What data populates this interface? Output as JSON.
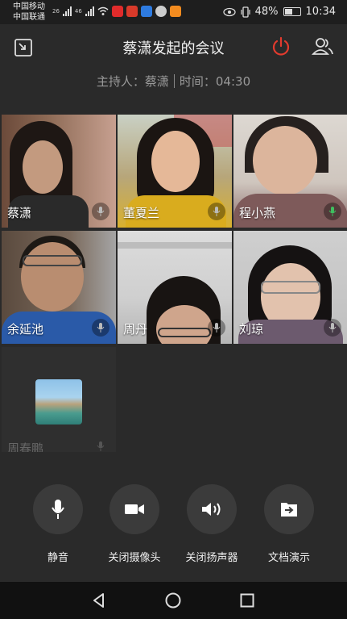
{
  "status_bar": {
    "carrier1": "中国移动",
    "carrier2": "中国联通",
    "network1": "26",
    "network2": "46",
    "battery_text": "48%",
    "time": "10:34"
  },
  "header": {
    "title": "蔡潇发起的会议",
    "host_label": "主持人：蔡潇",
    "time_label": "时间：04:30",
    "hangup_color": "#e23b2e"
  },
  "participants": [
    {
      "name": "蔡潇"
    },
    {
      "name": "董夏兰"
    },
    {
      "name": "程小燕"
    },
    {
      "name": "余延池"
    },
    {
      "name": "周丹"
    },
    {
      "name": "刘琼"
    },
    {
      "name": "周春鹏"
    }
  ],
  "controls": [
    {
      "label": "静音",
      "icon": "microphone-icon"
    },
    {
      "label": "关闭摄像头",
      "icon": "camera-icon"
    },
    {
      "label": "关闭扬声器",
      "icon": "speaker-icon"
    },
    {
      "label": "文档演示",
      "icon": "share-document-icon"
    }
  ],
  "navbar": {
    "back_icon": "back-triangle-icon",
    "home_icon": "home-circle-icon",
    "recents_icon": "recents-square-icon"
  }
}
